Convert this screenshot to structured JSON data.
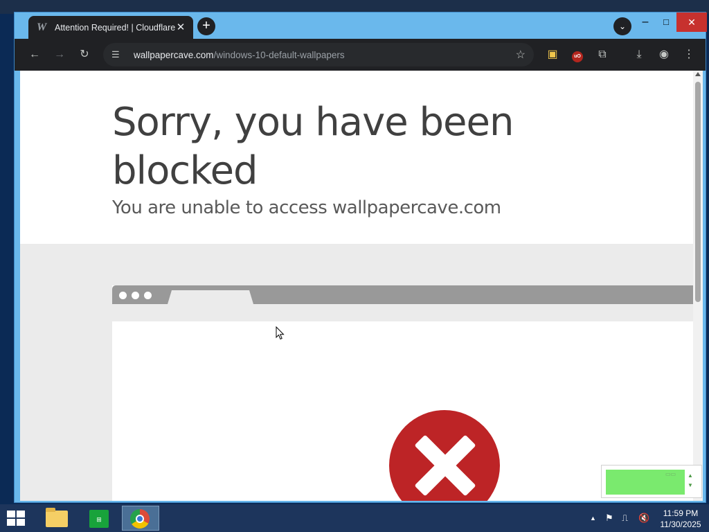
{
  "tab": {
    "title": "Attention Required! | Cloudflare",
    "favicon": "W"
  },
  "window_buttons": {
    "minimize": "–",
    "maximize": "□",
    "close": "✕"
  },
  "omnibox": {
    "host": "wallpapercave.com",
    "path": "/windows-10-default-wallpapers"
  },
  "page": {
    "headline": "Sorry, you have been blocked",
    "subline": "You are unable to access wallpapercave.com"
  },
  "tray": {
    "time": "11:59 PM",
    "date": "11/30/2025"
  },
  "colors": {
    "chrome_frame": "#6ab8ec",
    "toolbar": "#202124",
    "error_red": "#bd2426",
    "taskbar": "#1d355c"
  }
}
